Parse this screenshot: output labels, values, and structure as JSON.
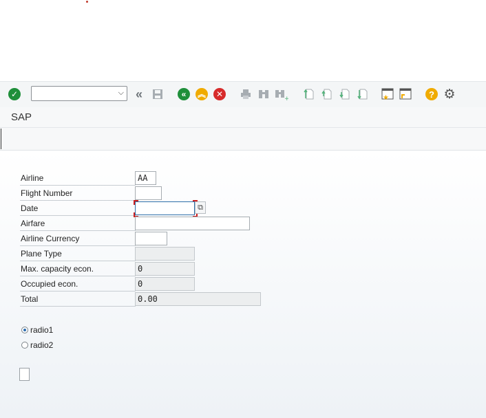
{
  "toolbar": {
    "command_field_value": "",
    "icons": [
      "check-icon",
      "back-double-icon",
      "save-icon",
      "back-icon",
      "exit-icon",
      "cancel-icon",
      "print-icon",
      "find-icon",
      "find-next-icon",
      "first-page-icon",
      "previous-page-icon",
      "next-page-icon",
      "last-page-icon",
      "create-session-icon",
      "shortcut-icon",
      "help-icon",
      "settings-icon"
    ]
  },
  "title": "SAP",
  "form": {
    "airline": {
      "label": "Airline",
      "value": "AA"
    },
    "flight_number": {
      "label": "Flight Number",
      "value": ""
    },
    "date": {
      "label": "Date",
      "value": ""
    },
    "airfare": {
      "label": "Airfare",
      "value": ""
    },
    "airline_currency": {
      "label": "Airline Currency",
      "value": ""
    },
    "plane_type": {
      "label": "Plane Type",
      "value": ""
    },
    "max_capacity": {
      "label": "Max. capacity econ.",
      "value": "0"
    },
    "occupied": {
      "label": "Occupied econ.",
      "value": "0"
    },
    "total": {
      "label": "Total",
      "value": "0.00"
    }
  },
  "radios": [
    {
      "label": "radio1",
      "selected": true
    },
    {
      "label": "radio2",
      "selected": false
    }
  ],
  "colors": {
    "accent_green": "#1f8f3a",
    "accent_orange": "#f0ab00",
    "accent_red": "#d72b2b",
    "focus_blue": "#2d6ea8"
  }
}
